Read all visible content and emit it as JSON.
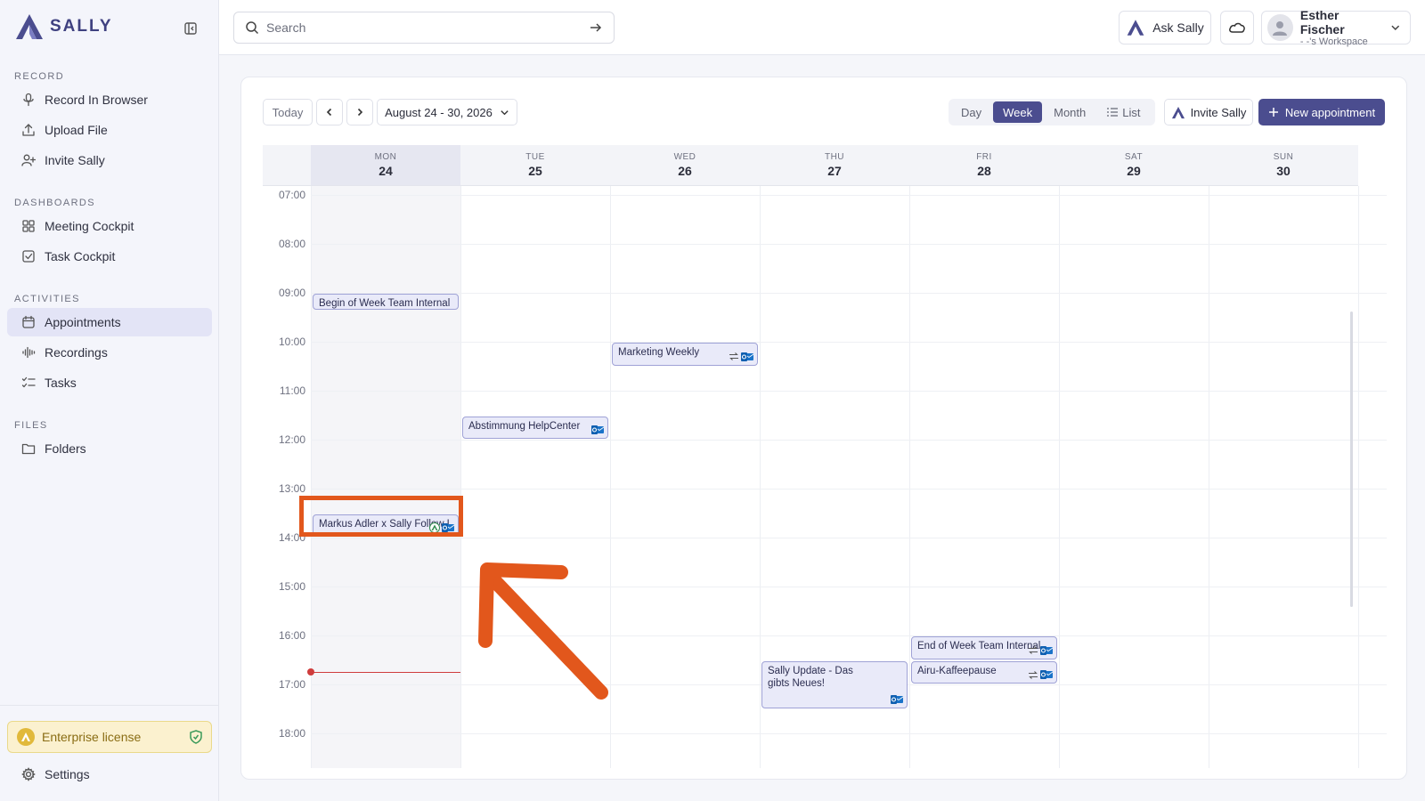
{
  "brand": {
    "name": "SALLY"
  },
  "sidebar": {
    "sections": [
      {
        "label": "RECORD",
        "items": [
          {
            "label": "Record In Browser",
            "icon": "microphone-icon"
          },
          {
            "label": "Upload File",
            "icon": "upload-icon"
          },
          {
            "label": "Invite Sally",
            "icon": "user-plus-icon"
          }
        ]
      },
      {
        "label": "DASHBOARDS",
        "items": [
          {
            "label": "Meeting Cockpit",
            "icon": "grid-icon"
          },
          {
            "label": "Task Cockpit",
            "icon": "checkbox-icon"
          }
        ]
      },
      {
        "label": "ACTIVITIES",
        "items": [
          {
            "label": "Appointments",
            "icon": "calendar-icon",
            "active": true
          },
          {
            "label": "Recordings",
            "icon": "waveform-icon"
          },
          {
            "label": "Tasks",
            "icon": "checklist-icon"
          }
        ]
      },
      {
        "label": "FILES",
        "items": [
          {
            "label": "Folders",
            "icon": "folder-icon"
          }
        ]
      }
    ],
    "license": "Enterprise license",
    "settings": "Settings"
  },
  "header": {
    "search_placeholder": "Search",
    "ask_label": "Ask Sally",
    "user_name": "Esther Fischer",
    "user_workspace": "- -'s Workspace"
  },
  "toolbar": {
    "today": "Today",
    "date_range": "August 24 - 30, 2026",
    "views": [
      "Day",
      "Week",
      "Month",
      "List"
    ],
    "active_view": "Week",
    "invite_label": "Invite Sally",
    "new_label": "New appointment"
  },
  "calendar": {
    "days": [
      {
        "name": "MON",
        "num": "24",
        "today": true
      },
      {
        "name": "TUE",
        "num": "25"
      },
      {
        "name": "WED",
        "num": "26"
      },
      {
        "name": "THU",
        "num": "27"
      },
      {
        "name": "FRI",
        "num": "28"
      },
      {
        "name": "SAT",
        "num": "29"
      },
      {
        "name": "SUN",
        "num": "30"
      }
    ],
    "hours": [
      "07:00",
      "08:00",
      "09:00",
      "10:00",
      "11:00",
      "12:00",
      "13:00",
      "14:00",
      "15:00",
      "16:00",
      "17:00",
      "18:00"
    ],
    "now": "16:45",
    "events": [
      {
        "title": "Begin of Week Team Internal",
        "day": 0,
        "start": "09:00",
        "end": "09:20",
        "recurring": false,
        "outlook": false,
        "sally": false
      },
      {
        "title": "Marketing Weekly",
        "day": 2,
        "start": "10:00",
        "end": "10:30",
        "recurring": true,
        "outlook": true,
        "sally": false
      },
      {
        "title": "Abstimmung HelpCenter",
        "day": 1,
        "start": "11:30",
        "end": "12:00",
        "recurring": false,
        "outlook": true,
        "sally": false
      },
      {
        "title": "Markus Adler x Sally Follow Up",
        "day": 0,
        "start": "13:30",
        "end": "14:00",
        "recurring": false,
        "outlook": true,
        "sally": true
      },
      {
        "title": "End of Week Team Internal",
        "day": 4,
        "start": "16:00",
        "end": "16:30",
        "recurring": true,
        "outlook": true,
        "sally": false
      },
      {
        "title": "Sally Update - Das gibts Neues!",
        "day": 3,
        "start": "16:30",
        "end": "17:30",
        "recurring": false,
        "outlook": true,
        "sally": false,
        "wrap": true
      },
      {
        "title": "Airu-Kaffeepause",
        "day": 4,
        "start": "16:30",
        "end": "17:00",
        "recurring": true,
        "outlook": true,
        "sally": false
      }
    ]
  },
  "colors": {
    "accent": "#4b4d8f",
    "annotation": "#e2571c",
    "now_line": "#cf3c3c"
  }
}
